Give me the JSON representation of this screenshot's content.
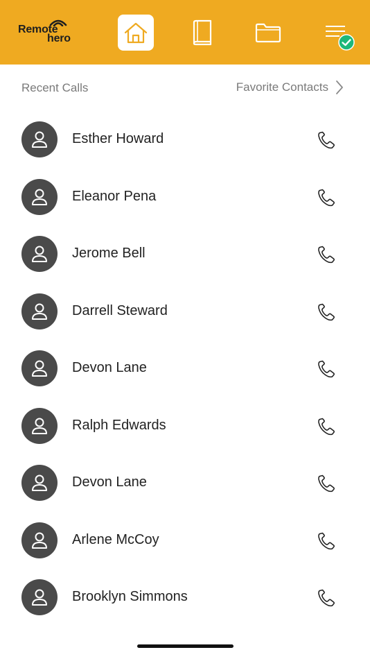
{
  "brand": {
    "logo_line1": "Remote",
    "logo_line2": "hero",
    "bar_color": "#EFAA21"
  },
  "nav": {
    "items": [
      {
        "icon": "home-icon",
        "active": true
      },
      {
        "icon": "book-icon",
        "active": false
      },
      {
        "icon": "folder-icon",
        "active": false
      },
      {
        "icon": "menu-icon",
        "active": false,
        "badge": "check-badge-icon"
      }
    ]
  },
  "tabs": {
    "recent_calls": "Recent Calls",
    "favorite_contacts": "Favorite Contacts"
  },
  "contacts": [
    {
      "name": "Esther Howard"
    },
    {
      "name": "Eleanor Pena"
    },
    {
      "name": "Jerome Bell"
    },
    {
      "name": "Darrell Steward"
    },
    {
      "name": "Devon Lane"
    },
    {
      "name": "Ralph Edwards"
    },
    {
      "name": "Devon Lane"
    },
    {
      "name": "Arlene McCoy"
    },
    {
      "name": "Brooklyn Simmons"
    }
  ],
  "colors": {
    "accent": "#EFAA21",
    "avatar_bg": "#4a4a4a",
    "badge_green": "#1DB87A"
  }
}
